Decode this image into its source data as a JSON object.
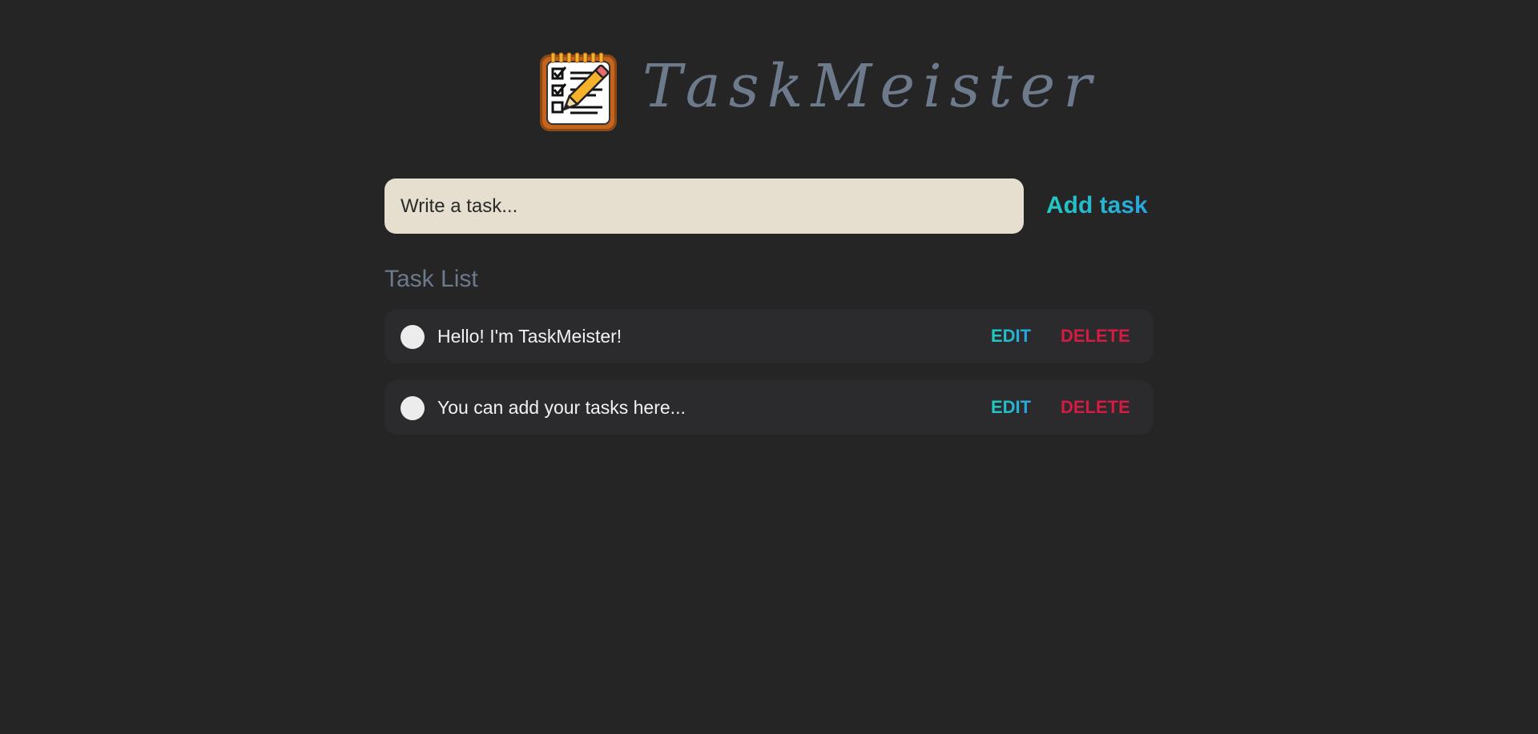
{
  "app": {
    "title": "TaskMeister",
    "logo_icon": "notepad-checklist-pencil-icon"
  },
  "new_task": {
    "placeholder": "Write a task...",
    "value": "",
    "add_label": "Add task"
  },
  "task_list": {
    "heading": "Task List",
    "edit_label": "EDIT",
    "delete_label": "DELETE",
    "tasks": [
      {
        "text": "Hello! I'm TaskMeister!",
        "completed": false
      },
      {
        "text": "You can add your tasks here...",
        "completed": false
      }
    ]
  },
  "colors": {
    "background": "#252525",
    "title": "#6c7a8c",
    "input_bg": "#e6dfd0",
    "accent": "#22c1cf",
    "delete": "#d41b42",
    "row_bg": "#2b2b2d"
  }
}
